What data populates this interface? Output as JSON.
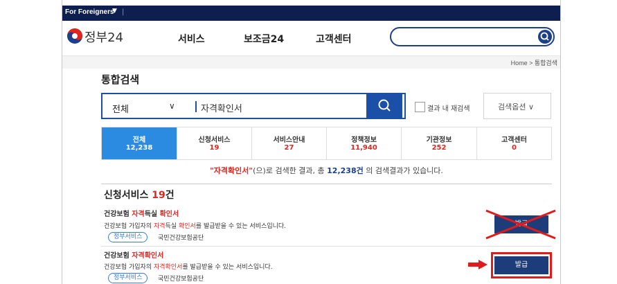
{
  "topbar": {
    "foreigners_label": "For Foreigners",
    "caret": "▼",
    "separator": "|"
  },
  "header": {
    "logo_text": "정부24",
    "nav": [
      "서비스",
      "보조금24",
      "고객센터"
    ],
    "search_placeholder": ""
  },
  "breadcrumb": "Home > 통합검색",
  "page_title": "통합검색",
  "search": {
    "category": "전체",
    "category_chevron": "∨",
    "query": "자격확인서",
    "refine_label": "결과 내 재검색",
    "options_label": "검색옵션 ∨"
  },
  "tabs": [
    {
      "label": "전체",
      "count": "12,238",
      "active": true
    },
    {
      "label": "신청서비스",
      "count": "19",
      "active": false
    },
    {
      "label": "서비스안내",
      "count": "27",
      "active": false
    },
    {
      "label": "정책정보",
      "count": "11,940",
      "active": false
    },
    {
      "label": "기관정보",
      "count": "252",
      "active": false
    },
    {
      "label": "고객센터",
      "count": "0",
      "active": false
    }
  ],
  "summary": {
    "keyword": "\"자격확인서\"",
    "text1": "(으)로 검색한 결과, 총 ",
    "total": "12,238건",
    "text2": " 의 검색결과가 있습니다."
  },
  "section": {
    "title": "신청서비스 ",
    "count": "19",
    "suffix": "건"
  },
  "items": [
    {
      "title_a": "건강보험 ",
      "title_hl1": "자격",
      "title_b": "득실 ",
      "title_hl2": "확인서",
      "title_c": "",
      "desc_a": "건강보험 가입자의 ",
      "desc_hl1": "자격",
      "desc_b": "득실 ",
      "desc_hl2": "확인서",
      "desc_c": "를 발급받을 수 있는 서비스입니다.",
      "tag": "정부서비스",
      "org": "국민건강보험공단",
      "button": "발급",
      "crossed_out": true
    },
    {
      "title_a": "건강보험 ",
      "title_hl1": "자격확인서",
      "title_b": "",
      "title_hl2": "",
      "title_c": "",
      "desc_a": "건강보험 가입자의 ",
      "desc_hl1": "자격확인서",
      "desc_b": "",
      "desc_hl2": "",
      "desc_c": "를 발급받을 수 있는 서비스입니다.",
      "tag": "정부서비스",
      "org": "국민건강보험공단",
      "button": "발급",
      "highlighted": true
    }
  ],
  "colors": {
    "topbar": "#0d1f4e",
    "brand_blue": "#1b4fa8",
    "active_tab": "#2a8be0",
    "highlight_red": "#e0251f",
    "button": "#1c3d7a",
    "annotation_red": "#e11b1b"
  }
}
